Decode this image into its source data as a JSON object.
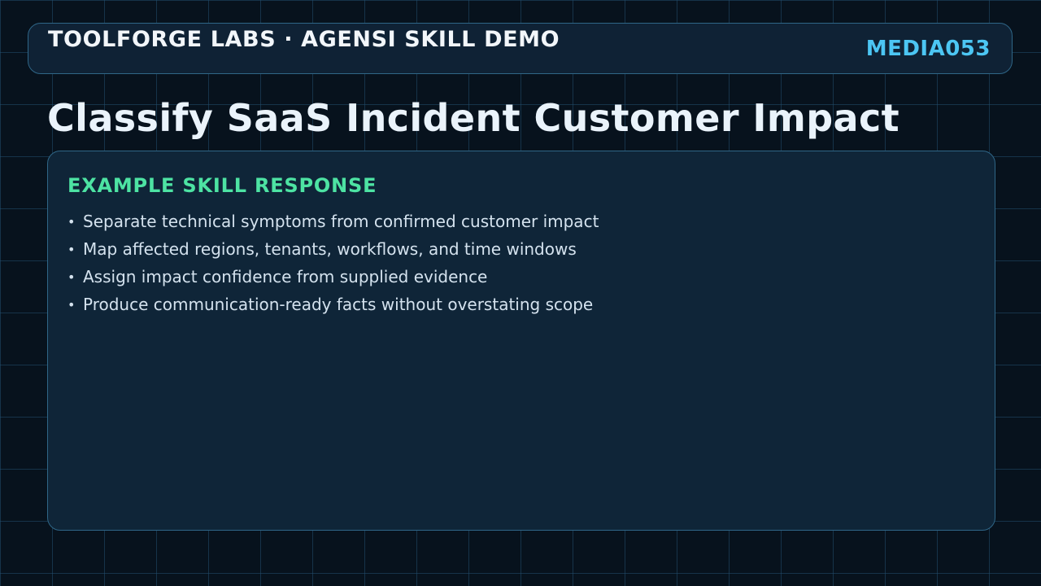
{
  "header": {
    "brand": "TOOLFORGE LABS · AGENSI SKILL DEMO",
    "code": "MEDIA053"
  },
  "page": {
    "title": "Classify SaaS Incident Customer Impact"
  },
  "card": {
    "heading": "EXAMPLE SKILL RESPONSE",
    "bullet_glyph": "•",
    "items": [
      "Separate technical symptoms from confirmed customer impact",
      "Map affected regions, tenants, workflows, and time windows",
      "Assign impact confidence from supplied evidence",
      "Produce communication-ready facts without overstating scope"
    ]
  },
  "colors": {
    "background": "#07121d",
    "panel": "#0f2538",
    "border": "#2f6687",
    "accent_cyan": "#4cc6f3",
    "accent_green": "#4de3a3",
    "title_text": "#eaf3fb",
    "body_text": "#d4e2ee"
  }
}
